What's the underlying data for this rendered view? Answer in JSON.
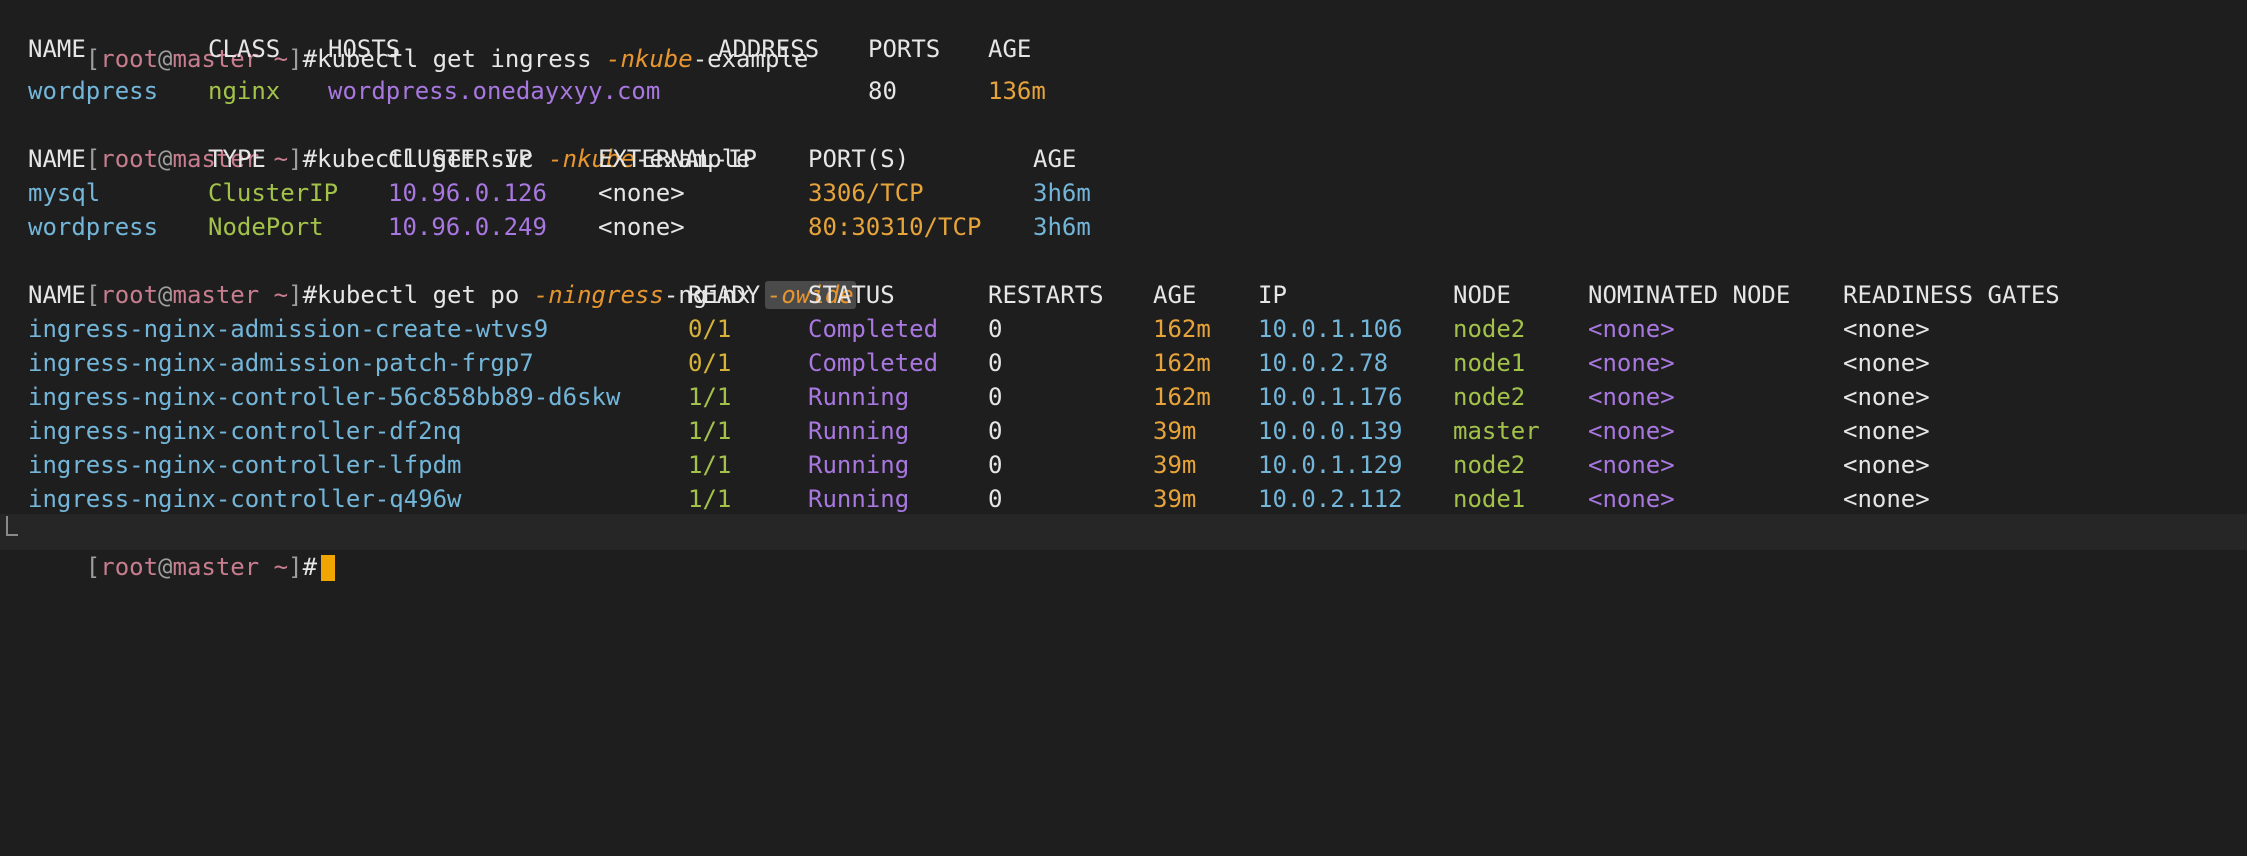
{
  "prompt": {
    "user": "root",
    "host": "master",
    "dir": "~"
  },
  "commands": [
    {
      "cmd": "#kubectl get ingress ",
      "flag_prefix": "-n",
      "flag_value": "kube",
      "tail": "-example"
    },
    {
      "cmd": "#kubectl get svc ",
      "flag_prefix": "-n",
      "flag_value": "kube",
      "tail": "-example"
    },
    {
      "cmd": "#kubectl get po ",
      "flag_prefix": "-n",
      "flag_value": "ingress",
      "tail": "-nginx ",
      "flag2": "-o",
      "flag2_value": "wide"
    }
  ],
  "ingress": {
    "headers": [
      "NAME",
      "CLASS",
      "HOSTS",
      "ADDRESS",
      "PORTS",
      "AGE"
    ],
    "rows": [
      {
        "name": "wordpress",
        "class": "nginx",
        "hosts": "wordpress.onedayxyy.com",
        "address": "",
        "ports": "80",
        "age": "136m"
      }
    ]
  },
  "services": {
    "headers": [
      "NAME",
      "TYPE",
      "CLUSTER-IP",
      "EXTERNAL-IP",
      "PORT(S)",
      "AGE"
    ],
    "rows": [
      {
        "name": "mysql",
        "type": "ClusterIP",
        "cluster_ip": "10.96.0.126",
        "external_ip": "<none>",
        "ports": "3306/TCP",
        "age": "3h6m"
      },
      {
        "name": "wordpress",
        "type": "NodePort",
        "cluster_ip": "10.96.0.249",
        "external_ip": "<none>",
        "ports": "80:30310/TCP",
        "age": "3h6m"
      }
    ]
  },
  "pods": {
    "headers": [
      "NAME",
      "READY",
      "STATUS",
      "RESTARTS",
      "AGE",
      "IP",
      "NODE",
      "NOMINATED NODE",
      "READINESS GATES"
    ],
    "rows": [
      {
        "name": "ingress-nginx-admission-create-wtvs9",
        "ready": "0/1",
        "status": "Completed",
        "restarts": "0",
        "age": "162m",
        "ip": "10.0.1.106",
        "node": "node2",
        "nominated": "<none>",
        "gates": "<none>"
      },
      {
        "name": "ingress-nginx-admission-patch-frgp7",
        "ready": "0/1",
        "status": "Completed",
        "restarts": "0",
        "age": "162m",
        "ip": "10.0.2.78",
        "node": "node1",
        "nominated": "<none>",
        "gates": "<none>"
      },
      {
        "name": "ingress-nginx-controller-56c858bb89-d6skw",
        "ready": "1/1",
        "status": "Running",
        "restarts": "0",
        "age": "162m",
        "ip": "10.0.1.176",
        "node": "node2",
        "nominated": "<none>",
        "gates": "<none>"
      },
      {
        "name": "ingress-nginx-controller-df2nq",
        "ready": "1/1",
        "status": "Running",
        "restarts": "0",
        "age": "39m",
        "ip": "10.0.0.139",
        "node": "master",
        "nominated": "<none>",
        "gates": "<none>"
      },
      {
        "name": "ingress-nginx-controller-lfpdm",
        "ready": "1/1",
        "status": "Running",
        "restarts": "0",
        "age": "39m",
        "ip": "10.0.1.129",
        "node": "node2",
        "nominated": "<none>",
        "gates": "<none>"
      },
      {
        "name": "ingress-nginx-controller-q496w",
        "ready": "1/1",
        "status": "Running",
        "restarts": "0",
        "age": "39m",
        "ip": "10.0.2.112",
        "node": "node1",
        "nominated": "<none>",
        "gates": "<none>"
      }
    ]
  },
  "final_prompt": {
    "hash": "#"
  },
  "colors": {
    "background": "#1e1e1e",
    "prompt": "#c77d8e",
    "flag": "#e7962f",
    "name": "#73b6d9",
    "ready": "#a3c24a",
    "purple": "#a877e0",
    "age": "#e7a43a",
    "cursor": "#f0a500"
  }
}
